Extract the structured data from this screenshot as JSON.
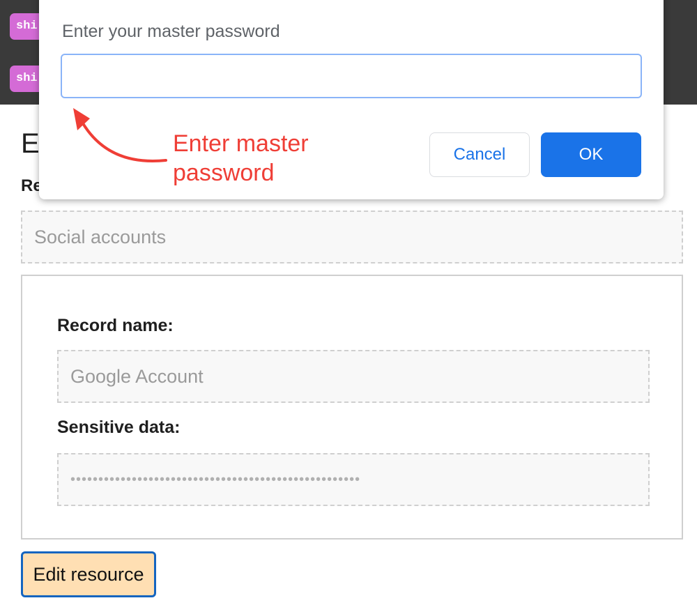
{
  "background_app": {
    "tags": [
      "shi",
      "shi"
    ],
    "heading": "E",
    "resource_label": "Re",
    "category_value": "Social accounts",
    "record_name_label": "Record name:",
    "record_name_value": "Google Account",
    "sensitive_label": "Sensitive data:",
    "sensitive_value": "••••••••••••••••••••••••••••••••••••••••••••••••••••",
    "edit_button_label": "Edit resource"
  },
  "dialog": {
    "prompt": "Enter your master password",
    "input_value": "",
    "cancel_label": "Cancel",
    "ok_label": "OK"
  },
  "annotation": {
    "text": "Enter master password",
    "color": "#ef3e36"
  },
  "colors": {
    "tag": "#d46bd6",
    "topbar": "#3a3a3a",
    "primary": "#1a73e8",
    "edit_button_bg": "#ffdfb3",
    "edit_button_border": "#1565c0"
  }
}
